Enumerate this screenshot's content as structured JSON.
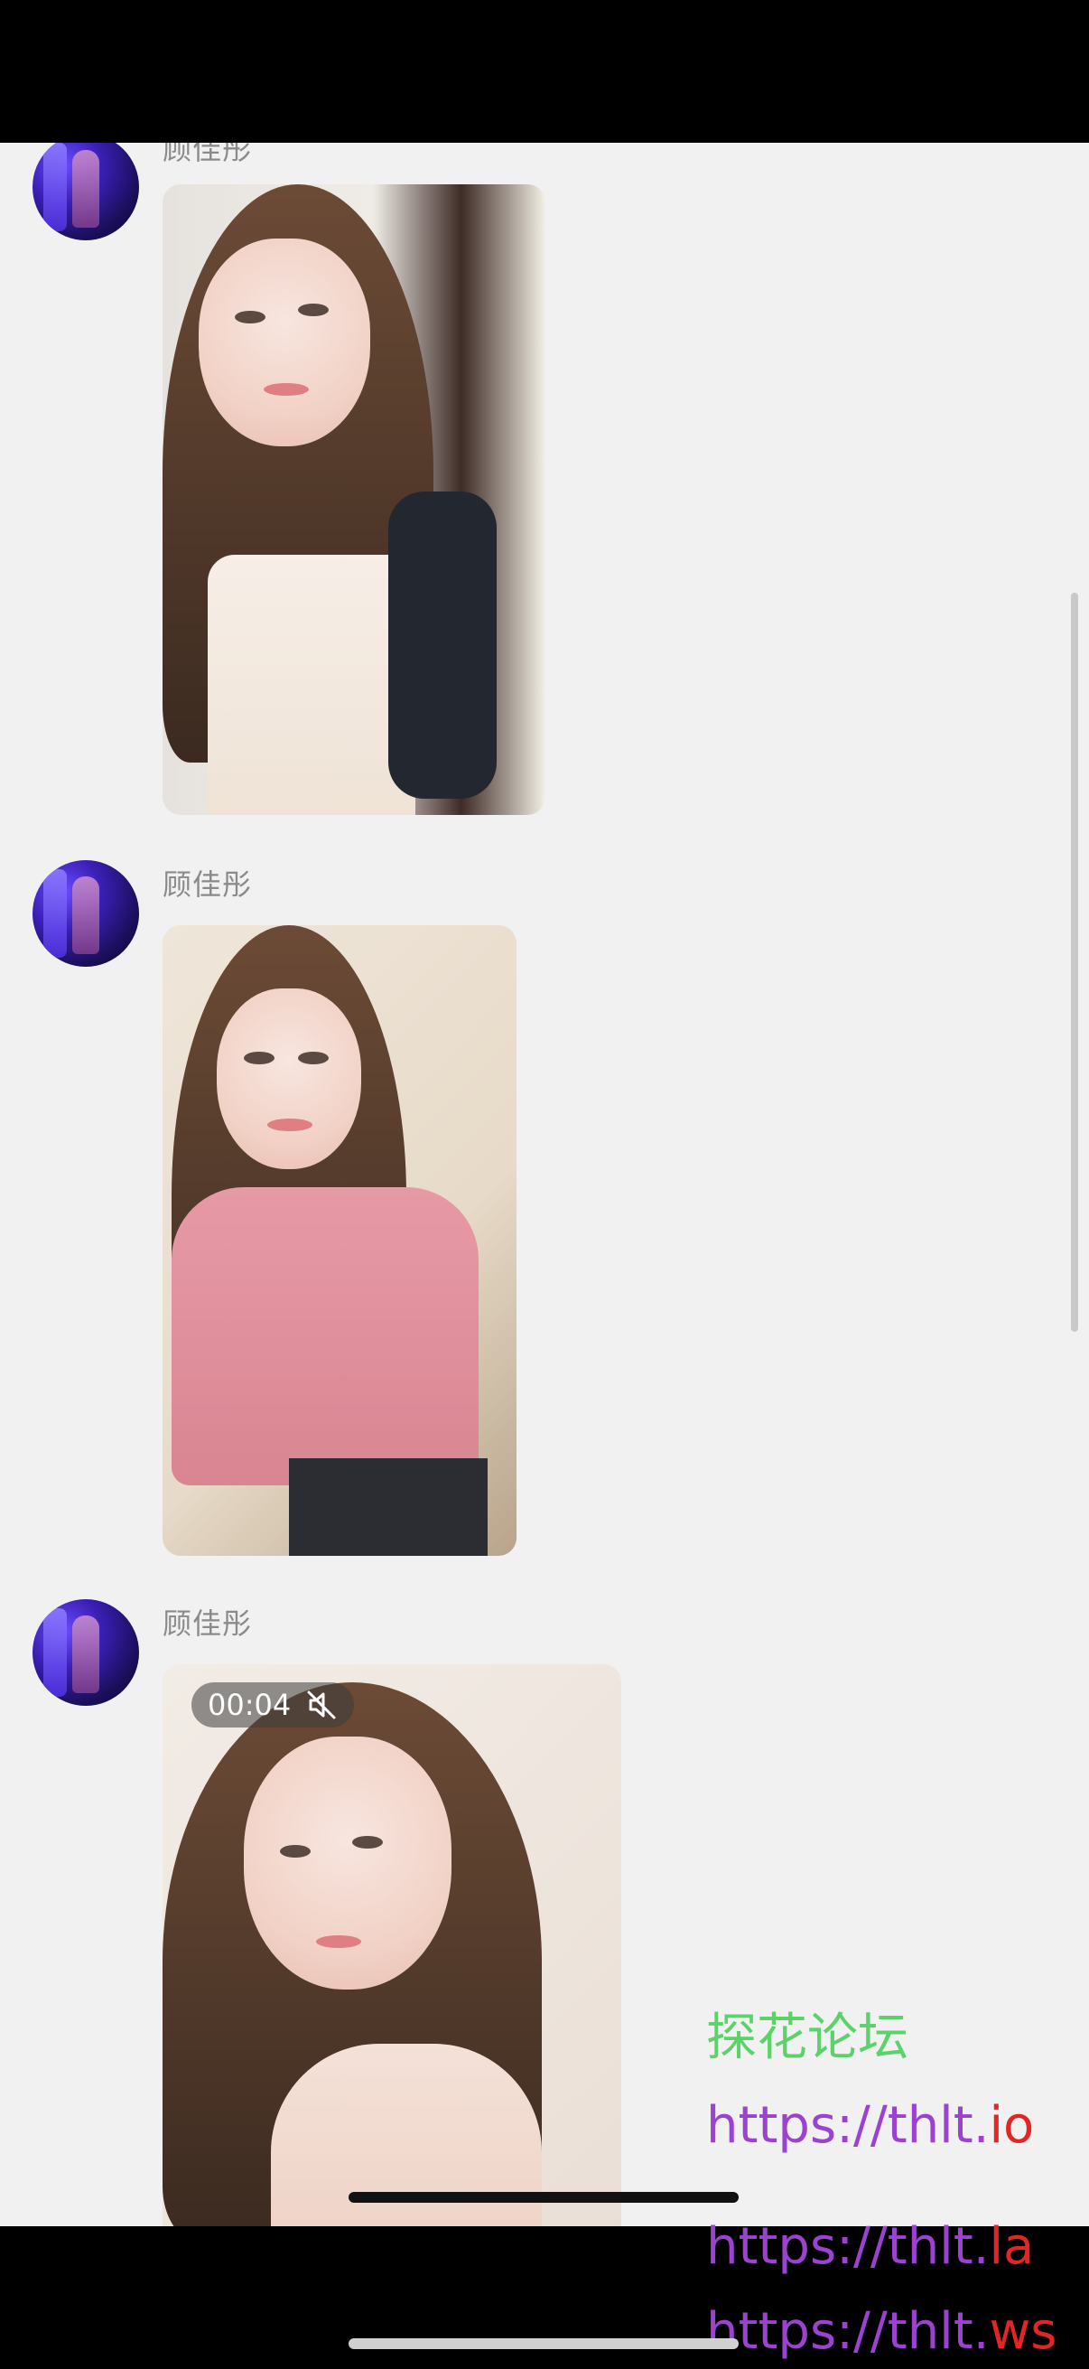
{
  "messages": [
    {
      "sender": "顾佳彤",
      "type": "image"
    },
    {
      "sender": "顾佳彤",
      "type": "image"
    },
    {
      "sender": "顾佳彤",
      "type": "video",
      "duration": "00:04",
      "muted_icon": "speaker-muted-icon"
    }
  ],
  "watermark": {
    "forum_name": "探花论坛",
    "urls": [
      {
        "base": "https://thlt.",
        "tld": "io"
      },
      {
        "base": "https://thlt.",
        "tld": "la"
      },
      {
        "base": "https://thlt.",
        "tld": "ws"
      }
    ]
  },
  "colors": {
    "chat_background": "#f1f1f1",
    "sender_text": "#8a8a8a",
    "watermark_green": "#5bd36a",
    "watermark_purple": "#9b42d0",
    "watermark_red": "#e42525"
  }
}
